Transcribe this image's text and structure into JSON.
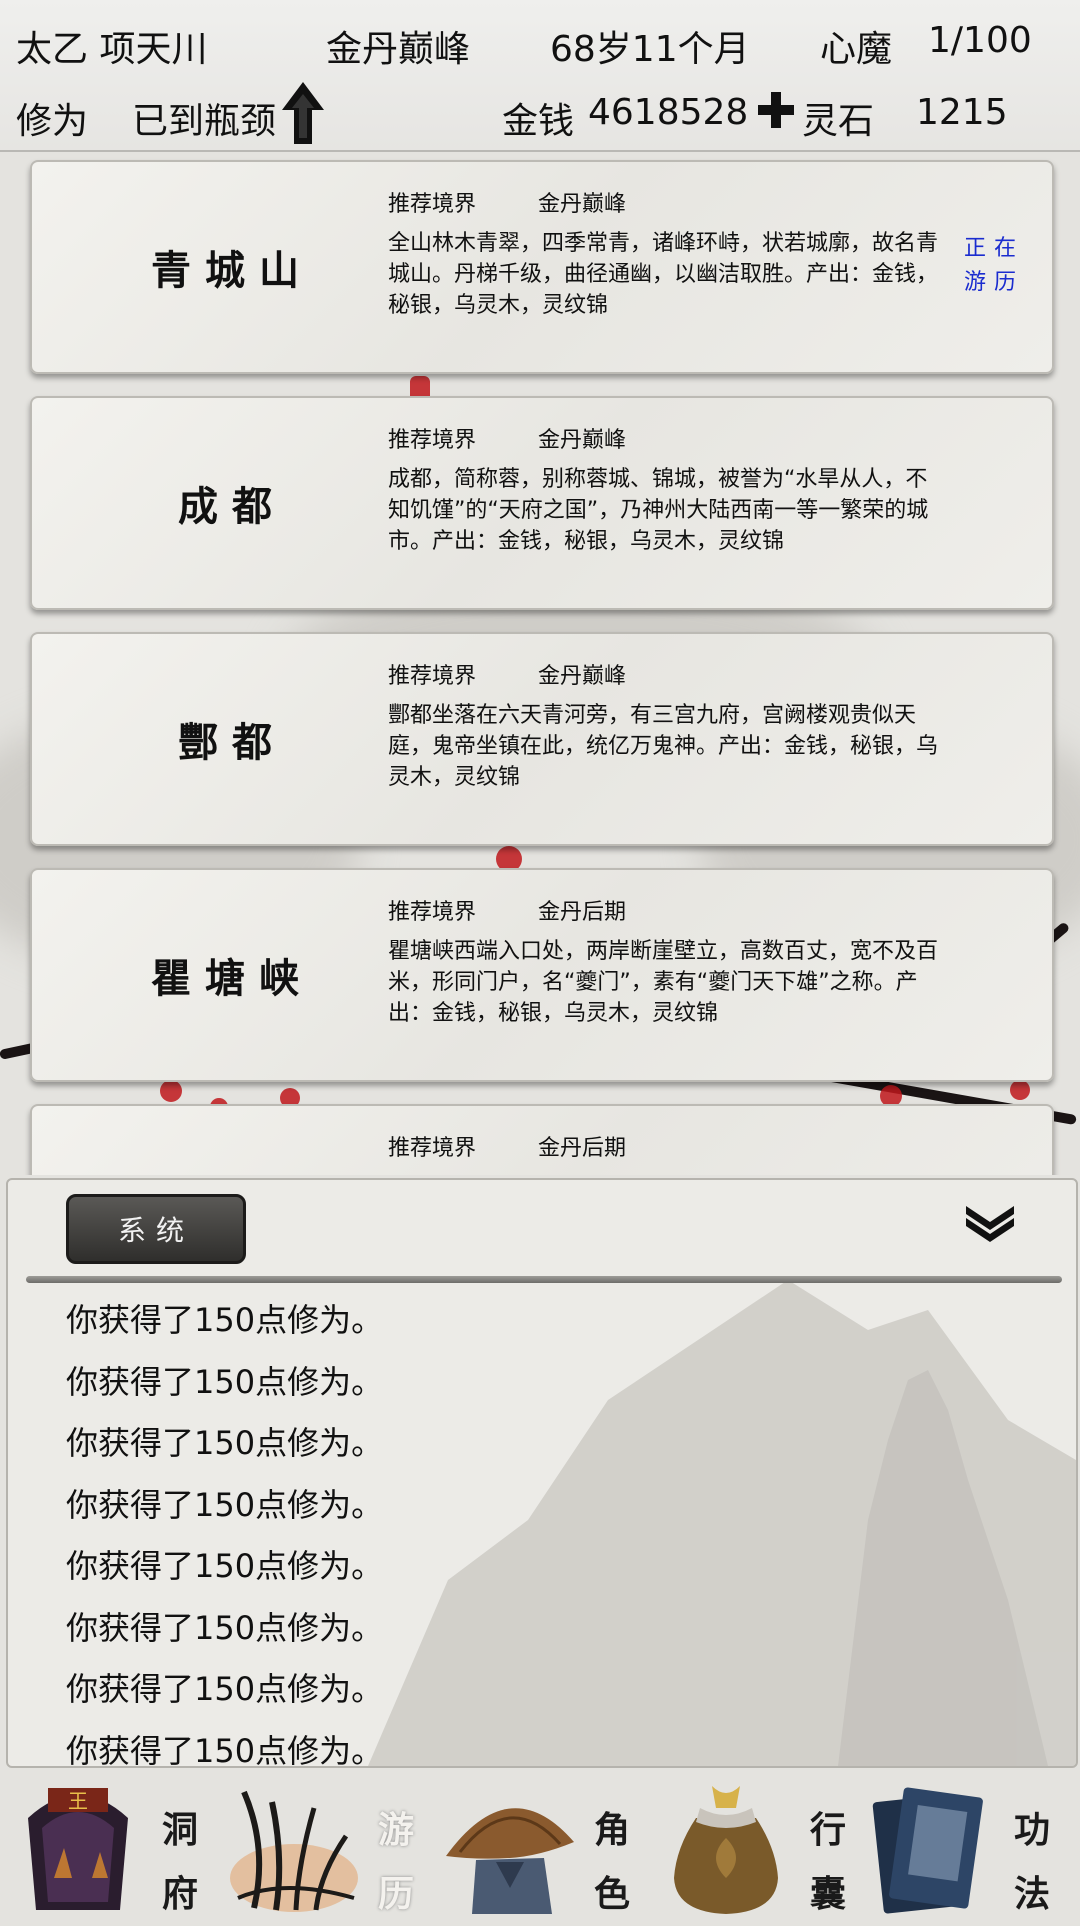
{
  "header": {
    "character_name": "太乙 项天川",
    "realm": "金丹巅峰",
    "age": "68岁11个月",
    "heart_demon_label": "心魔",
    "heart_demon_value": "1/100",
    "cultivation_label": "修为",
    "cultivation_status": "已到瓶颈",
    "money_label": "金钱",
    "money_value": "4618528",
    "spirit_stone_label": "灵石",
    "spirit_stone_value": "1215"
  },
  "locations": [
    {
      "name": "青城山",
      "realm_label": "推荐境界",
      "realm": "金丹巅峰",
      "description": "全山林木青翠，四季常青，诸峰环峙，状若城廓，故名青城山。丹梯千级，曲径通幽，以幽洁取胜。产出：金钱，秘银，乌灵木，灵纹锦",
      "status_line1": "正在",
      "status_line2": "游历"
    },
    {
      "name": "成都",
      "realm_label": "推荐境界",
      "realm": "金丹巅峰",
      "description": "成都，简称蓉，别称蓉城、锦城，被誉为“水旱从人，不知饥馑”的“天府之国”，乃神州大陆西南一等一繁荣的城市。产出：金钱，秘银，乌灵木，灵纹锦"
    },
    {
      "name": "酆都",
      "realm_label": "推荐境界",
      "realm": "金丹巅峰",
      "description": "酆都坐落在六天青河旁，有三宫九府，宫阙楼观贵似天庭，鬼帝坐镇在此，统亿万鬼神。产出：金钱，秘银，乌灵木，灵纹锦"
    },
    {
      "name": "瞿塘峡",
      "realm_label": "推荐境界",
      "realm": "金丹后期",
      "description": "瞿塘峡西端入口处，两岸断崖壁立，高数百丈，宽不及百米，形同门户，名“夔门”，素有“夔门天下雄”之称。产出：金钱，秘银，乌灵木，灵纹锦"
    },
    {
      "realm_label": "推荐境界",
      "realm": "金丹后期"
    }
  ],
  "log": {
    "tab_label": "系统",
    "lines": [
      "你获得了150点修为。",
      "你获得了150点修为。",
      "你获得了150点修为。",
      "你获得了150点修为。",
      "你获得了150点修为。",
      "你获得了150点修为。",
      "你获得了150点修为。",
      "你获得了150点修为。"
    ]
  },
  "nav": {
    "items": [
      {
        "top": "洞",
        "bottom": "府",
        "icon": "cave-dwelling-icon"
      },
      {
        "top": "游",
        "bottom": "历",
        "icon": "travel-grass-icon",
        "active": true
      },
      {
        "top": "角",
        "bottom": "色",
        "icon": "character-hat-icon"
      },
      {
        "top": "行",
        "bottom": "囊",
        "icon": "bag-pouch-icon"
      },
      {
        "top": "功",
        "bottom": "法",
        "icon": "technique-books-icon"
      }
    ]
  },
  "colors": {
    "status_tag": "#1a2ccf",
    "blossom": "#c0181c",
    "tab_bg": "#3d3c3a"
  }
}
